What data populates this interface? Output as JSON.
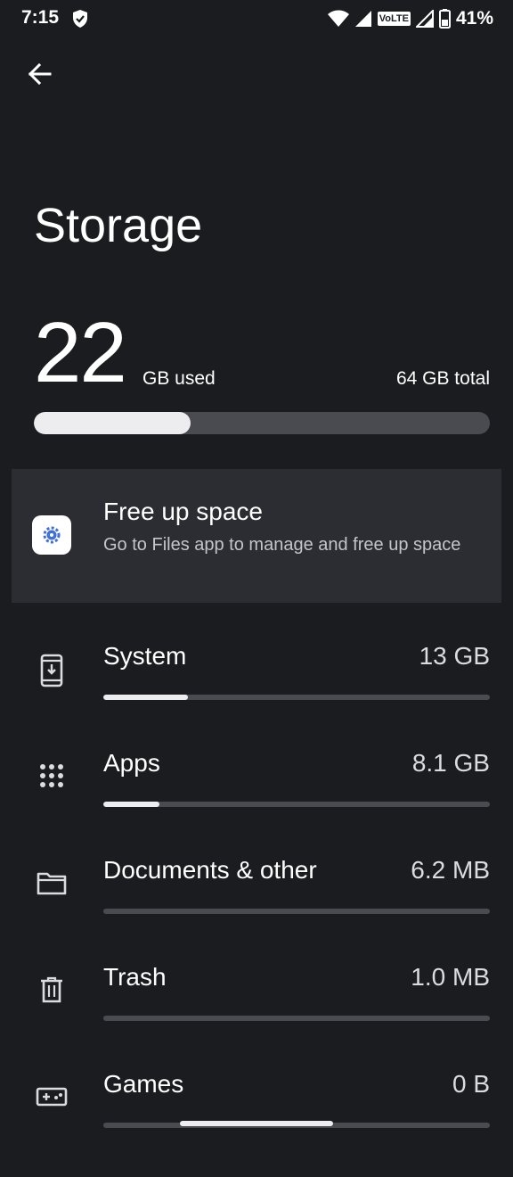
{
  "status_bar": {
    "time": "7:15",
    "volte": "VoLTE",
    "battery_percent": "41%",
    "icons": [
      "shield-icon",
      "wifi-icon",
      "signal-icon",
      "battery-icon"
    ]
  },
  "header": {
    "title": "Storage"
  },
  "summary": {
    "used_value": "22",
    "used_unit": "GB used",
    "total": "64 GB total",
    "used_fraction": 0.344
  },
  "free_up": {
    "title": "Free up space",
    "subtitle": "Go to Files app to manage and free up space",
    "icon": "files-app-icon"
  },
  "categories": [
    {
      "label": "System",
      "size": "13 GB",
      "fraction": 0.22,
      "icon": "system-update-icon"
    },
    {
      "label": "Apps",
      "size": "8.1 GB",
      "fraction": 0.145,
      "icon": "apps-grid-icon"
    },
    {
      "label": "Documents & other",
      "size": "6.2 MB",
      "fraction": 0,
      "icon": "folder-icon"
    },
    {
      "label": "Trash",
      "size": "1.0 MB",
      "fraction": 0,
      "icon": "trash-icon"
    },
    {
      "label": "Games",
      "size": "0 B",
      "fraction": 0,
      "icon": "gamepad-icon"
    }
  ],
  "colors": {
    "background": "#1b1c20",
    "card": "#2c2d32",
    "bar_track": "#4a4b50",
    "bar_fill": "#ededf0",
    "accent_blue": "#3f6fd8"
  }
}
